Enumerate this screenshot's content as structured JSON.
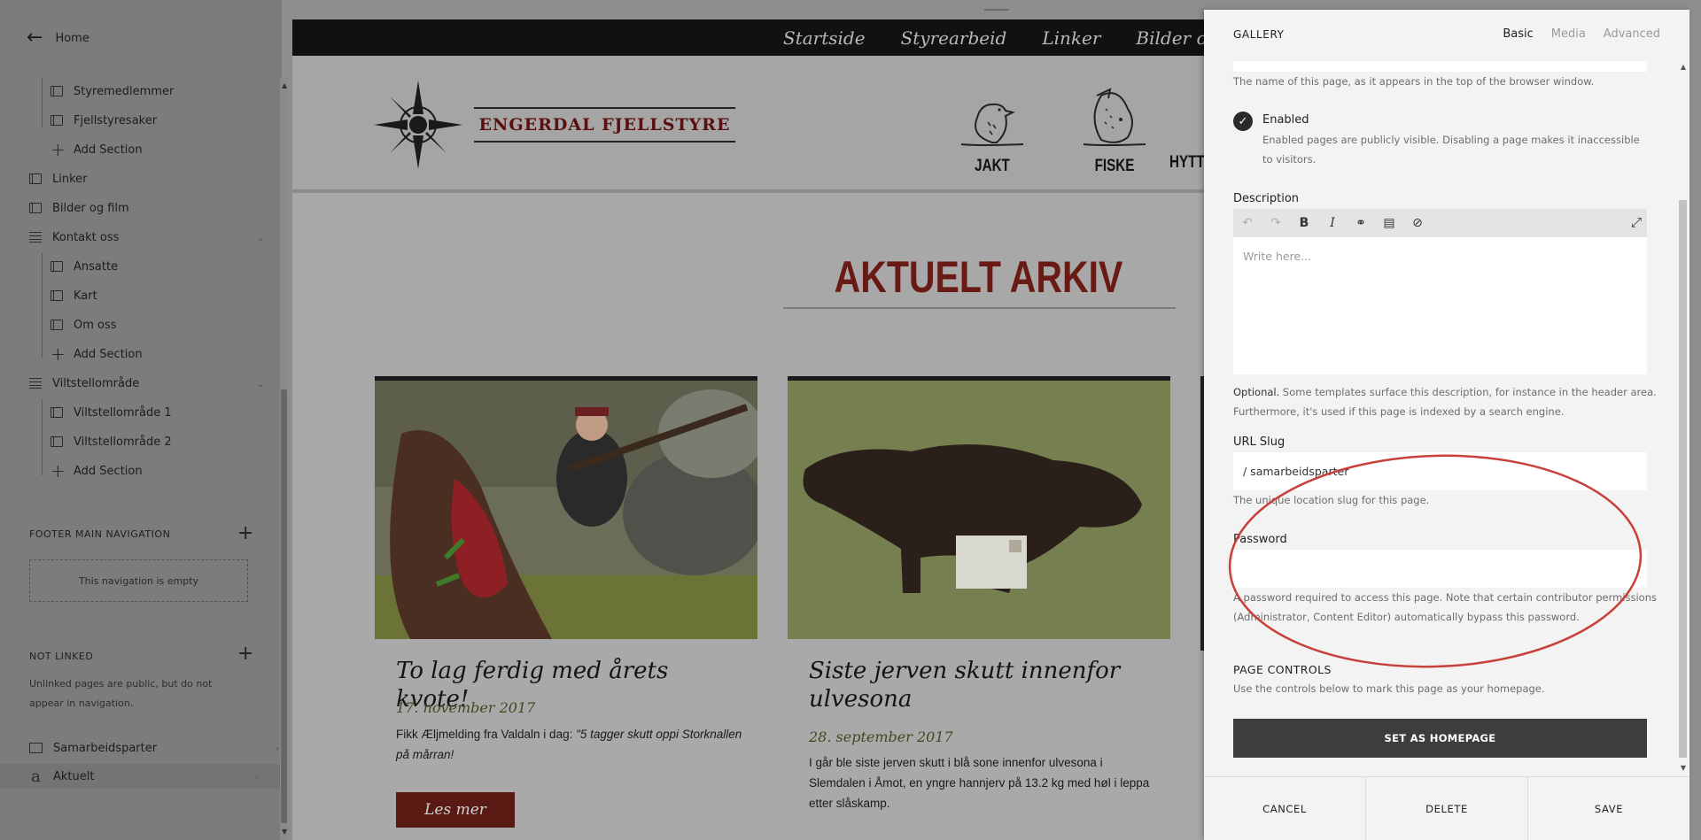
{
  "sidebar": {
    "home_label": "Home",
    "items": [
      {
        "label": "Styremedlemmer",
        "type": "page",
        "indent": 1
      },
      {
        "label": "Fjellstyresaker",
        "type": "page",
        "indent": 1
      },
      {
        "label": "Add Section",
        "type": "add",
        "indent": 1
      },
      {
        "label": "Linker",
        "type": "page",
        "indent": 0
      },
      {
        "label": "Bilder og film",
        "type": "page",
        "indent": 0
      },
      {
        "label": "Kontakt oss",
        "type": "folder",
        "indent": 0
      },
      {
        "label": "Ansatte",
        "type": "page",
        "indent": 1
      },
      {
        "label": "Kart",
        "type": "page",
        "indent": 1
      },
      {
        "label": "Om oss",
        "type": "page",
        "indent": 1
      },
      {
        "label": "Add Section",
        "type": "add",
        "indent": 1
      },
      {
        "label": "Viltstellområde",
        "type": "folder",
        "indent": 0
      },
      {
        "label": "Viltstellområde 1",
        "type": "page",
        "indent": 1
      },
      {
        "label": "Viltstellområde 2",
        "type": "page",
        "indent": 1
      },
      {
        "label": "Add Section",
        "type": "add",
        "indent": 1
      }
    ],
    "footer_nav_heading": "FOOTER MAIN NAVIGATION",
    "footer_nav_empty": "This navigation is empty",
    "not_linked_heading": "NOT LINKED",
    "not_linked_desc": "Unlinked pages are public, but do not appear in navigation.",
    "unlinked_items": [
      {
        "label": "Samarbeidsparter",
        "icon": "gallery-icon"
      },
      {
        "label": "Aktuelt",
        "icon": "blog-icon"
      }
    ]
  },
  "site": {
    "nav": [
      "Startside",
      "Styrearbeid",
      "Linker",
      "Bilder og film"
    ],
    "logo_text": "ENGERDAL FJELLSTYRE",
    "header_links": [
      "JAKT",
      "FISKE",
      "HYTT"
    ],
    "page_title": "AKTUELT ARKIV",
    "cards": [
      {
        "title": "To lag ferdig med årets kvote!",
        "date": "17. november 2017",
        "body_lead": "Fikk Æljmelding fra Valdaln i dag: ",
        "body_quote": "\"5 tagger skutt oppi Storknallen på mårran!",
        "button": "Les mer"
      },
      {
        "title": "Siste jerven skutt innenfor ulvesona",
        "date": "28. september 2017",
        "body_lead": "I går ble siste jerven skutt i blå sone innenfor ulvesona i Slemdalen i Åmot, en yngre hannjerv på 13.2 kg med høl i leppa etter slåskamp.",
        "body_quote": "",
        "button": ""
      }
    ]
  },
  "panel": {
    "title": "GALLERY",
    "tabs": [
      "Basic",
      "Media",
      "Advanced"
    ],
    "active_tab": "Basic",
    "name_help": "The name of this page, as it appears in the top of the browser window.",
    "enabled_label": "Enabled",
    "enabled_help": "Enabled pages are publicly visible. Disabling a page makes it inaccessible to visitors.",
    "description_label": "Description",
    "description_placeholder": "Write here...",
    "description_help_bold": "Optional.",
    "description_help": " Some templates surface this description, for instance in the header area. Furthermore, it's used if this page is indexed by a search engine.",
    "slug_label": "URL Slug",
    "slug_value": "/ samarbeidsparter",
    "slug_help": "The unique location slug for this page.",
    "password_label": "Password",
    "password_value": "",
    "password_help": "A password required to access this page. Note that certain contributor permissions (Administrator, Content Editor) automatically bypass this password.",
    "page_controls_heading": "PAGE CONTROLS",
    "page_controls_help": "Use the controls below to mark this page as your homepage.",
    "homepage_button": "SET AS HOMEPAGE",
    "cancel": "CANCEL",
    "delete": "DELETE",
    "save": "SAVE"
  },
  "colors": {
    "annotation": "#c8403a",
    "brand_red": "#6a1a14",
    "panel_bg": "#f3f3f3"
  }
}
